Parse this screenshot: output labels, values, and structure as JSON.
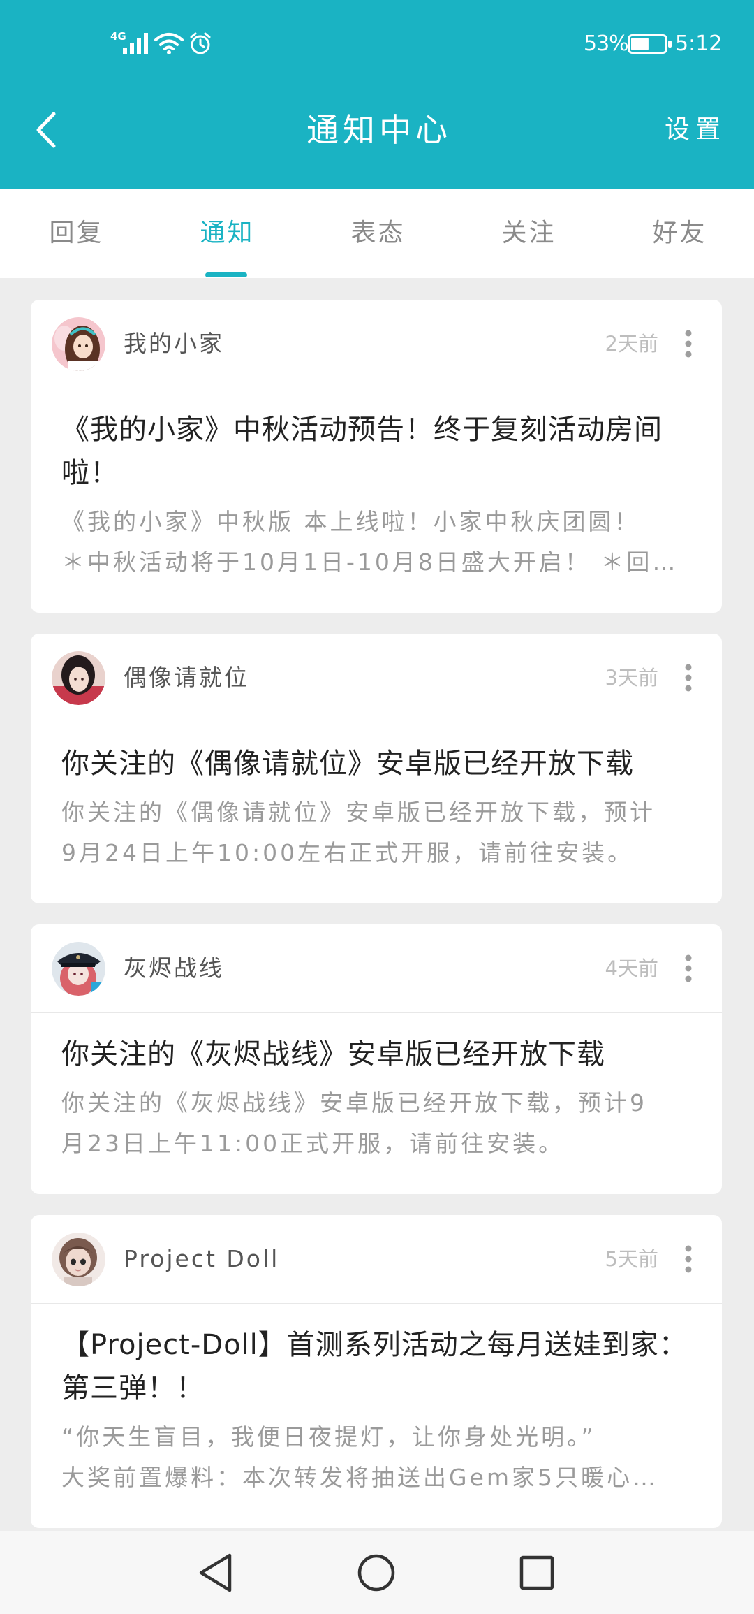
{
  "colors": {
    "accent": "#1ab3c3",
    "background": "#ededed",
    "card": "#ffffff",
    "title_text": "#222222",
    "desc_text": "#9a9a9a",
    "meta_text": "#bdbdbd"
  },
  "status_bar": {
    "network": "4G",
    "icons": [
      "signal-icon",
      "wifi-icon",
      "alarm-icon",
      "battery-icon"
    ],
    "battery_text": "53%",
    "battery_level": 0.53,
    "time": "5:12"
  },
  "header": {
    "back_icon": "chevron-left-icon",
    "title": "通知中心",
    "settings_label": "设置"
  },
  "tabs": [
    {
      "label": "回复",
      "active": false
    },
    {
      "label": "通知",
      "active": true
    },
    {
      "label": "表态",
      "active": false
    },
    {
      "label": "关注",
      "active": false
    },
    {
      "label": "好友",
      "active": false
    }
  ],
  "notifications": [
    {
      "source": "我的小家",
      "avatar_icon": "girl-avatar",
      "time": "2天前",
      "title_lines": [
        "《我的小家》中秋活动预告！终于复刻活动房间",
        "啦！"
      ],
      "desc_lines": [
        "《我的小家》中秋版 本上线啦！小家中秋庆团圆！",
        "＊中秋活动将于10月1日-10月8日盛大开启！ ＊回…"
      ]
    },
    {
      "source": "偶像请就位",
      "avatar_icon": "idol-avatar",
      "time": "3天前",
      "title_lines": [
        "你关注的《偶像请就位》安卓版已经开放下载"
      ],
      "desc_lines": [
        "你关注的《偶像请就位》安卓版已经开放下载，预计",
        "9月24日上午10:00左右正式开服，请前往安装。"
      ]
    },
    {
      "source": "灰烬战线",
      "avatar_icon": "officer-avatar",
      "time": "4天前",
      "title_lines": [
        "你关注的《灰烬战线》安卓版已经开放下载"
      ],
      "desc_lines": [
        "你关注的《灰烬战线》安卓版已经开放下载，预计9",
        "月23日上午11:00正式开服，请前往安装。"
      ]
    },
    {
      "source": "Project Doll",
      "avatar_icon": "doll-avatar",
      "time": "5天前",
      "title_lines": [
        "【Project-Doll】首测系列活动之每月送娃到家：",
        "第三弹！！"
      ],
      "desc_lines": [
        "“你天生盲目，我便日夜提灯，让你身处光明。”",
        "大奖前置爆料：本次转发将抽送出Gem家5只暖心…"
      ]
    }
  ],
  "nav_bar": {
    "icons": [
      "back-triangle-icon",
      "home-circle-icon",
      "recents-square-icon"
    ]
  }
}
